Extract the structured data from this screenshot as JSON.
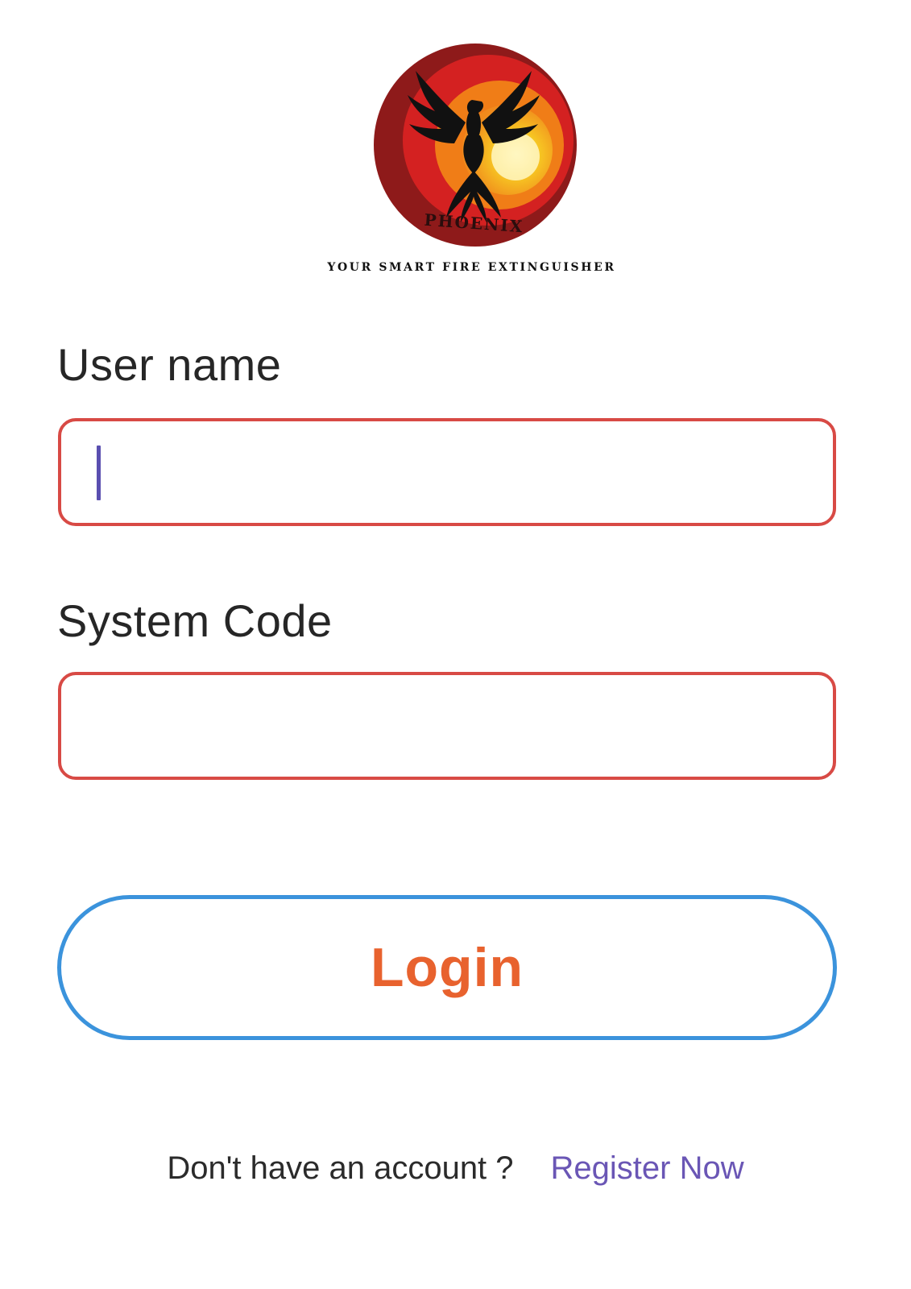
{
  "logo": {
    "wordmark": "PHOENIX",
    "tagline": "YOUR SMART FIRE EXTINGUISHER"
  },
  "form": {
    "username_label": "User name",
    "username_value": "",
    "system_code_label": "System Code",
    "system_code_value": ""
  },
  "login_button": {
    "label": "Login"
  },
  "footer": {
    "prompt": "Don't have an account ?",
    "register_label": "Register Now"
  },
  "colors": {
    "input_border": "#d84a45",
    "login_border": "#3b93dc",
    "login_text": "#e8622e",
    "register_link": "#6a56b5",
    "caret": "#5a4fb0"
  },
  "icons": {
    "logo": "phoenix-logo-icon"
  }
}
